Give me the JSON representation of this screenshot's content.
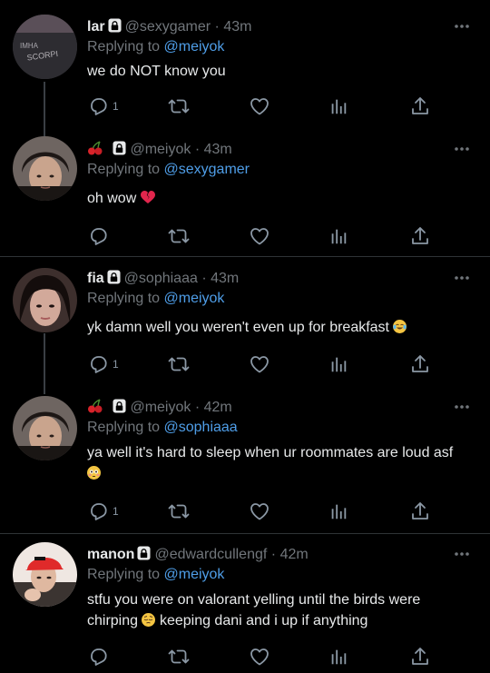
{
  "tweets": [
    {
      "name": "lar",
      "handle": "@sexygamer",
      "time": "43m",
      "replying_prefix": "Replying to",
      "replying_to": "@meiyok",
      "text": "we do NOT know you",
      "reply_count": "1",
      "avatar_text_top": "SCORPI",
      "avatar_text_bottom": "IMHA"
    },
    {
      "name": "",
      "handle": "@meiyok",
      "time": "43m",
      "replying_prefix": "Replying to",
      "replying_to": "@sexygamer",
      "text": "oh wow",
      "reply_count": ""
    },
    {
      "name": "fia",
      "handle": "@sophiaaa",
      "time": "43m",
      "replying_prefix": "Replying to",
      "replying_to": "@meiyok",
      "text": "yk damn well you weren't even up for breakfast",
      "reply_count": "1"
    },
    {
      "name": "",
      "handle": "@meiyok",
      "time": "42m",
      "replying_prefix": "Replying to",
      "replying_to": "@sophiaaa",
      "text_line1": "ya well it's hard to sleep when ur roommates are loud asf",
      "reply_count": "1"
    },
    {
      "name": "manon",
      "handle": "@edwardcullengf",
      "time": "42m",
      "replying_prefix": "Replying to",
      "replying_to": "@meiyok",
      "text_line1": "stfu you were on valorant yelling until the birds were",
      "text_line2a": "chirping",
      "text_line2b": "keeping dani and i up if anything",
      "reply_count": ""
    }
  ],
  "separator": "·",
  "icons": {
    "reply": "reply-icon",
    "retweet": "retweet-icon",
    "like": "heart-icon",
    "views": "analytics-icon",
    "share": "share-icon",
    "more": "more-icon",
    "protected": "lock-icon"
  },
  "colors": {
    "background": "#000000",
    "link": "#4f9ee8",
    "muted": "#71767b",
    "text": "#e7e9ea"
  }
}
